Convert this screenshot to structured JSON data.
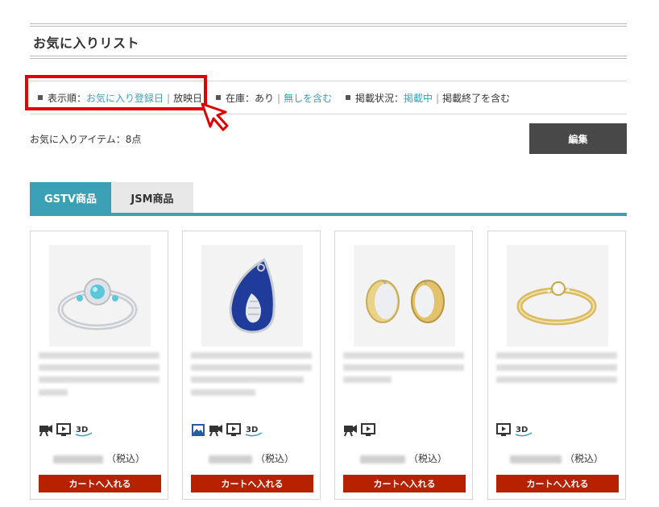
{
  "page": {
    "title": "お気に入りリスト",
    "item_count_text": "お気に入りアイテム：8点",
    "edit_label": "編集"
  },
  "filters": {
    "sort_label": "表示順：",
    "sort_options": [
      "お気に入り登録日",
      "放映日"
    ],
    "stock_label": "在庫：",
    "stock_options": [
      "あり",
      "無しを含む"
    ],
    "listing_label": "掲載状況：",
    "listing_options": [
      "掲載中",
      "掲載終了を含む"
    ]
  },
  "tabs": [
    {
      "label": "GSTV商品",
      "active": true
    },
    {
      "label": "JSM商品",
      "active": false
    }
  ],
  "products": [
    {
      "image": "ring-with-blue-gemstone",
      "icons": [
        "video-camera-icon",
        "play-screen-icon",
        "3d-icon"
      ],
      "tax_label": "（税込）",
      "cart_label": "カートへ入れる"
    },
    {
      "image": "blue-sapphire-teardrop-pendant",
      "icons": [
        "photo-icon",
        "video-camera-icon",
        "play-screen-icon",
        "3d-icon"
      ],
      "tax_label": "（税込）",
      "cart_label": "カートへ入れる"
    },
    {
      "image": "gold-silver-hoop-earrings",
      "icons": [
        "video-camera-icon",
        "play-screen-icon"
      ],
      "tax_label": "（税込）",
      "cart_label": "カートへ入れる"
    },
    {
      "image": "gold-diamond-ring",
      "icons": [
        "play-screen-icon",
        "3d-icon"
      ],
      "tax_label": "（税込）",
      "cart_label": "カートへ入れる"
    }
  ],
  "colors": {
    "accent": "#3aa1b5",
    "cart_button": "#b62100",
    "edit_button": "#484848",
    "highlight": "#e00000"
  }
}
